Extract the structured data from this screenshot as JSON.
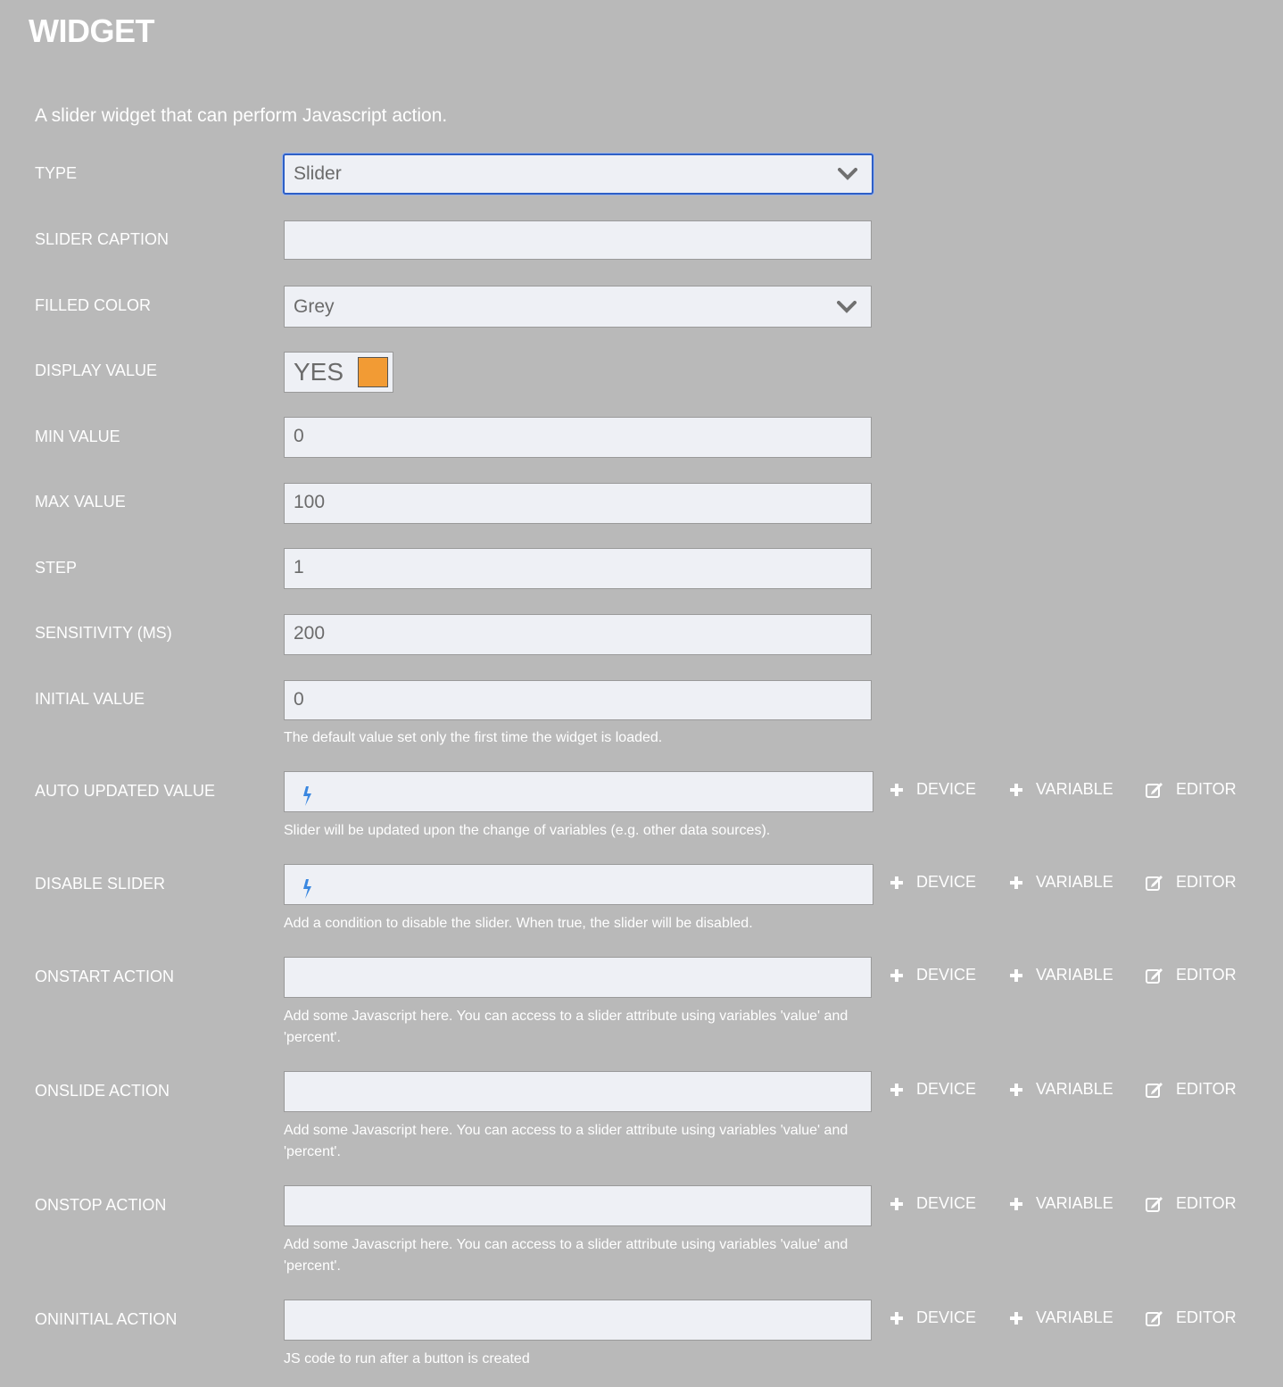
{
  "header": {
    "title": "WIDGET"
  },
  "description": "A slider widget that can perform Javascript action.",
  "fields": {
    "type": {
      "label": "TYPE",
      "value": "Slider"
    },
    "slider_caption": {
      "label": "SLIDER CAPTION",
      "value": ""
    },
    "filled_color": {
      "label": "FILLED COLOR",
      "value": "Grey"
    },
    "display_value": {
      "label": "DISPLAY VALUE",
      "value": "YES",
      "swatch_color": "#f29b34"
    },
    "min_value": {
      "label": "MIN VALUE",
      "value": "0"
    },
    "max_value": {
      "label": "MAX VALUE",
      "value": "100"
    },
    "step": {
      "label": "STEP",
      "value": "1"
    },
    "sensitivity": {
      "label": "SENSITIVITY (MS)",
      "value": "200"
    },
    "initial_value": {
      "label": "INITIAL VALUE",
      "value": "0",
      "help": "The default value set only the first time the widget is loaded."
    },
    "auto_updated_value": {
      "label": "AUTO UPDATED VALUE",
      "value": "",
      "help": "Slider will be updated upon the change of variables (e.g. other data sources)."
    },
    "disable_slider": {
      "label": "DISABLE SLIDER",
      "value": "",
      "help": "Add a condition to disable the slider. When true, the slider will be disabled."
    },
    "onstart_action": {
      "label": "ONSTART ACTION",
      "value": "",
      "help_line1": "Add some Javascript here. You can access to a slider attribute using variables 'value' and",
      "help_line2": "'percent'."
    },
    "onslide_action": {
      "label": "ONSLIDE ACTION",
      "value": "",
      "help_line1": "Add some Javascript here. You can access to a slider attribute using variables 'value' and",
      "help_line2": "'percent'."
    },
    "onstop_action": {
      "label": "ONSTOP ACTION",
      "value": "",
      "help_line1": "Add some Javascript here. You can access to a slider attribute using variables 'value' and",
      "help_line2": "'percent'."
    },
    "oninitial_action": {
      "label": "ONINITIAL ACTION",
      "value": "",
      "help": "JS code to run after a button is created"
    }
  },
  "actions": {
    "device": "DEVICE",
    "variable": "VARIABLE",
    "editor": "EDITOR"
  },
  "icons": {
    "dropdown": "chevron-down-icon",
    "bolt": "lightning-bolt-icon",
    "plus": "plus-icon",
    "editor": "edit-icon"
  },
  "colors": {
    "background": "#b9b9b9",
    "field": "#eef0f5",
    "focus": "#2e5fc6",
    "bolt": "#3a87e0"
  }
}
